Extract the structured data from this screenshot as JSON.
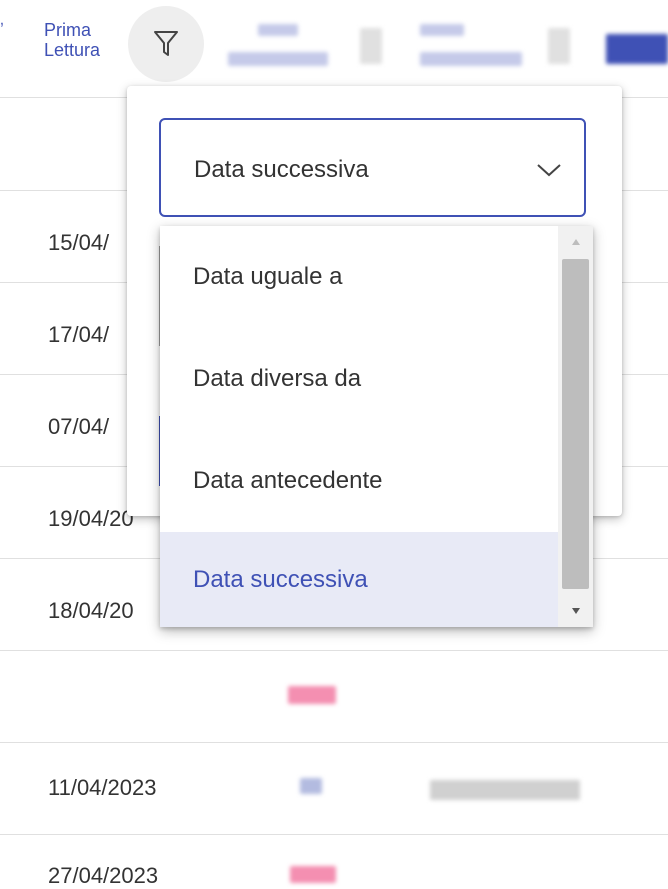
{
  "header": {
    "edge_glyph": "ʼ",
    "column_title_line1": "Prima",
    "column_title_line2": "Lettura"
  },
  "table": {
    "dates": [
      "15/04/",
      "17/04/",
      "07/04/",
      "19/04/20",
      "18/04/20",
      "",
      "11/04/2023",
      "27/04/2023"
    ]
  },
  "filter": {
    "selected_condition": "Data successiva",
    "options": [
      {
        "label": "Data uguale a",
        "selected": false
      },
      {
        "label": "Data diversa da",
        "selected": false
      },
      {
        "label": "Data antecedente",
        "selected": false
      },
      {
        "label": "Data successiva",
        "selected": true
      }
    ]
  },
  "colors": {
    "accent": "#3f51b5",
    "selected_bg": "#e8eaf6",
    "text": "#333333",
    "divider": "#e0e0e0"
  },
  "icons": {
    "filter": "funnel-icon",
    "dropdown": "chevron-down-icon",
    "scroll_up": "triangle-up-icon",
    "scroll_down": "triangle-down-icon"
  }
}
